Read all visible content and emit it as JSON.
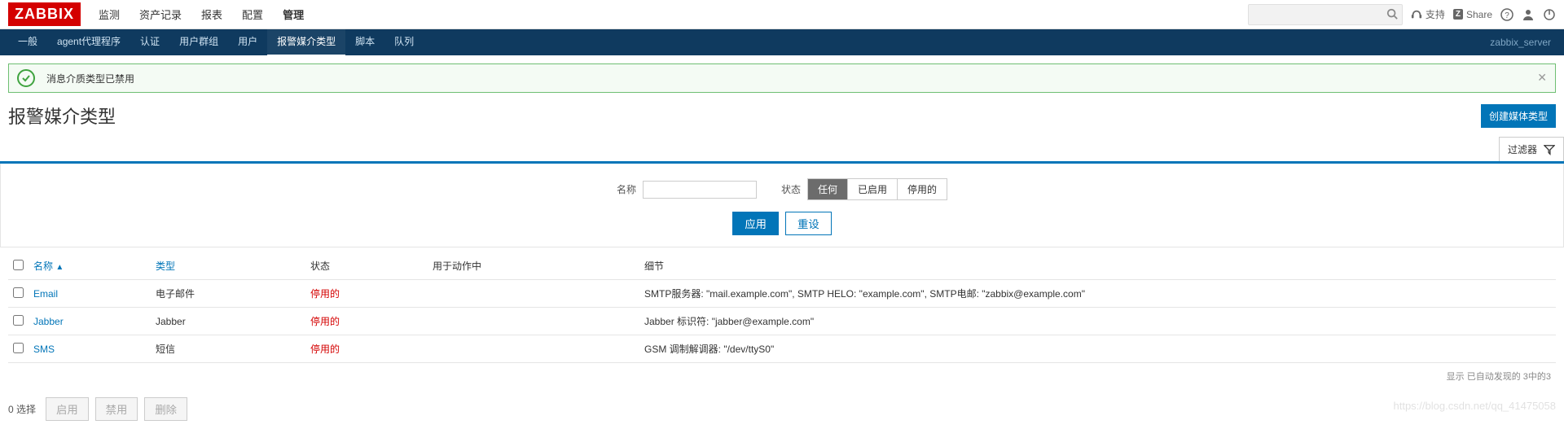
{
  "brand": "ZABBIX",
  "top_menu": [
    "监测",
    "资产记录",
    "报表",
    "配置",
    "管理"
  ],
  "top_menu_selected": 4,
  "support_label": "支持",
  "share_label": "Share",
  "sub_menu": [
    "一般",
    "agent代理程序",
    "认证",
    "用户群组",
    "用户",
    "报警媒介类型",
    "脚本",
    "队列"
  ],
  "sub_menu_selected": 5,
  "server_label": "zabbix_server",
  "message_text": "消息介质类型已禁用",
  "page_title": "报警媒介类型",
  "create_button": "创建媒体类型",
  "filter_tab_label": "过滤器",
  "filter": {
    "name_label": "名称",
    "name_value": "",
    "status_label": "状态",
    "status_options": [
      "任何",
      "已启用",
      "停用的"
    ],
    "status_selected": 0,
    "apply_label": "应用",
    "reset_label": "重设"
  },
  "columns": {
    "name": "名称",
    "type": "类型",
    "status": "状态",
    "used_in": "用于动作中",
    "details": "细节"
  },
  "rows": [
    {
      "name": "Email",
      "type": "电子邮件",
      "status": "停用的",
      "details": "SMTP服务器: \"mail.example.com\", SMTP HELO: \"example.com\", SMTP电邮: \"zabbix@example.com\""
    },
    {
      "name": "Jabber",
      "type": "Jabber",
      "status": "停用的",
      "details": "Jabber 标识符: \"jabber@example.com\""
    },
    {
      "name": "SMS",
      "type": "短信",
      "status": "停用的",
      "details": "GSM 调制解调器: \"/dev/ttyS0\""
    }
  ],
  "table_info": "显示 已自动发现的 3中的3",
  "footer": {
    "selected_count": "0 选择",
    "enable": "启用",
    "disable": "禁用",
    "delete": "删除"
  },
  "watermark": "https://blog.csdn.net/qq_41475058"
}
